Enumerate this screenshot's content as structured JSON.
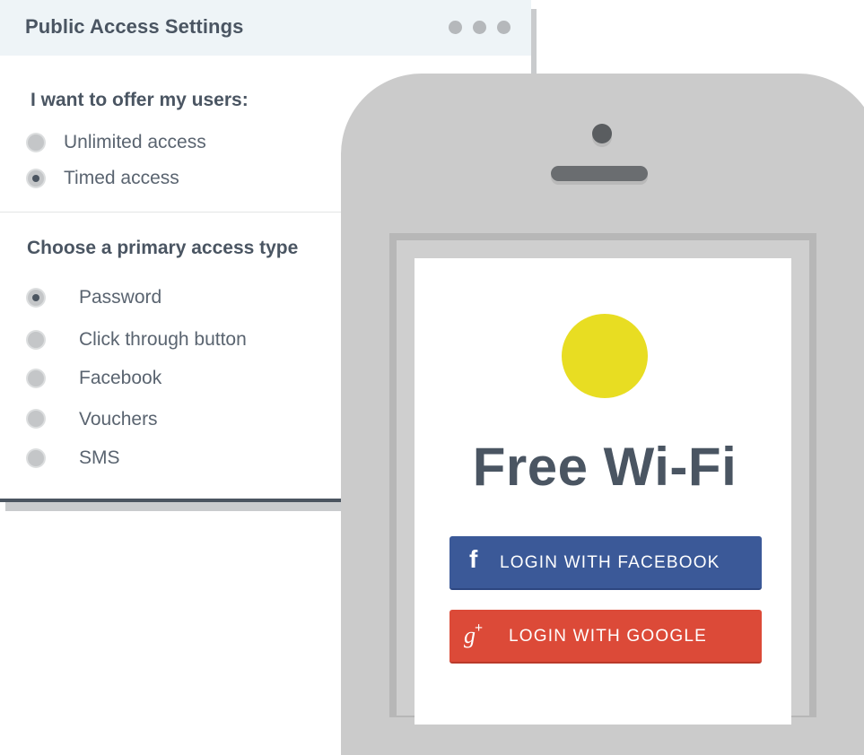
{
  "panel": {
    "title": "Public Access Settings",
    "offer_heading": "I want to offer my users:",
    "offer_options": [
      {
        "label": "Unlimited access",
        "selected": false
      },
      {
        "label": "Timed access",
        "selected": true
      }
    ],
    "access_heading": "Choose a primary access type",
    "access_options": [
      {
        "label": "Password",
        "selected": true
      },
      {
        "label": "Click through button",
        "selected": false
      },
      {
        "label": "Facebook",
        "selected": false
      },
      {
        "label": "Vouchers",
        "selected": false
      },
      {
        "label": "SMS",
        "selected": false
      }
    ]
  },
  "phone": {
    "title": "Free Wi-Fi",
    "facebook_button": {
      "icon": "facebook-icon",
      "glyph": "f",
      "label": "LOGIN WITH FACEBOOK",
      "color": "#3b5998"
    },
    "google_button": {
      "icon": "google-plus-icon",
      "glyph": "g",
      "glyph_plus": "+",
      "label": "LOGIN WITH GOOGLE",
      "color": "#dc4a38"
    },
    "logo_color": "#e8dd22"
  },
  "colors": {
    "text": "#4a5562",
    "header_bg": "#eef4f7",
    "phone_body": "#cbcbcb"
  }
}
